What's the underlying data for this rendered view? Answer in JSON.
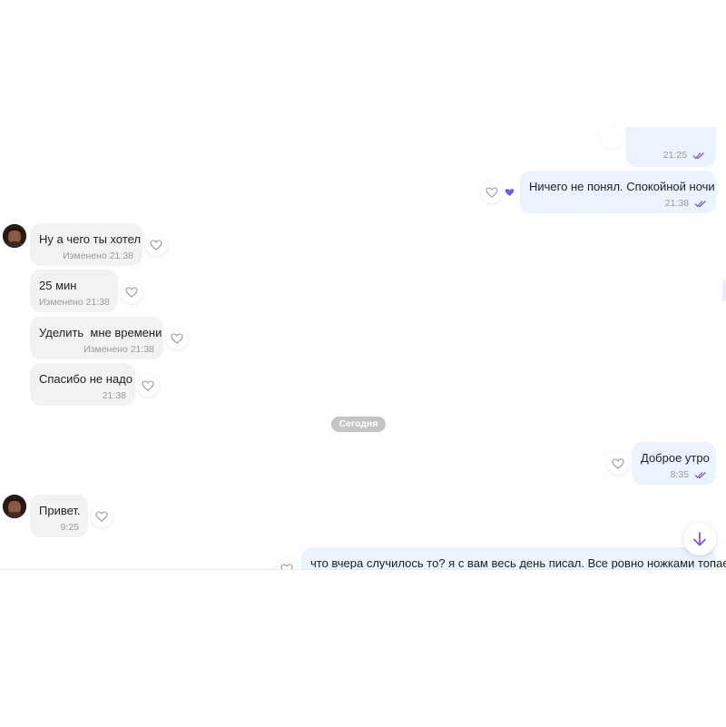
{
  "colors": {
    "incoming_bubble": "#f2f2f3",
    "outgoing_bubble": "#eaf3fe",
    "accent": "#7a5cd8",
    "date_badge": "#c4c4c4"
  },
  "messages": [
    {
      "direction": "out",
      "text": "",
      "time": "21:25",
      "read": true
    },
    {
      "direction": "out",
      "text": "Ничего не понял. Спокойной ночи",
      "time": "21:38",
      "read": true,
      "liked": true
    },
    {
      "direction": "in",
      "text": "Ну а чего ты хотел",
      "time": "Изменено 21:38"
    },
    {
      "direction": "in",
      "text": "25 мин",
      "time": "Изменено 21:38"
    },
    {
      "direction": "in",
      "text": "Уделить  мне времени",
      "time": "Изменено 21:38"
    },
    {
      "direction": "in",
      "text": "Спасибо не надо",
      "time": "21:38"
    },
    {
      "direction": "out",
      "text": "Доброе утро",
      "time": "8:35",
      "read": true
    },
    {
      "direction": "in",
      "text": "Привет.",
      "time": "9:25"
    },
    {
      "direction": "out",
      "text": "что вчера случилось то? я с вам весь день писал. Все ровно ножками топаете",
      "time": ""
    }
  ],
  "date_separator": "Сегодня",
  "icons": {
    "like": "heart-outline-icon",
    "liked": "heart-filled-icon",
    "read": "double-check-icon",
    "scroll": "arrow-down-icon",
    "avatar": "contact-avatar"
  }
}
